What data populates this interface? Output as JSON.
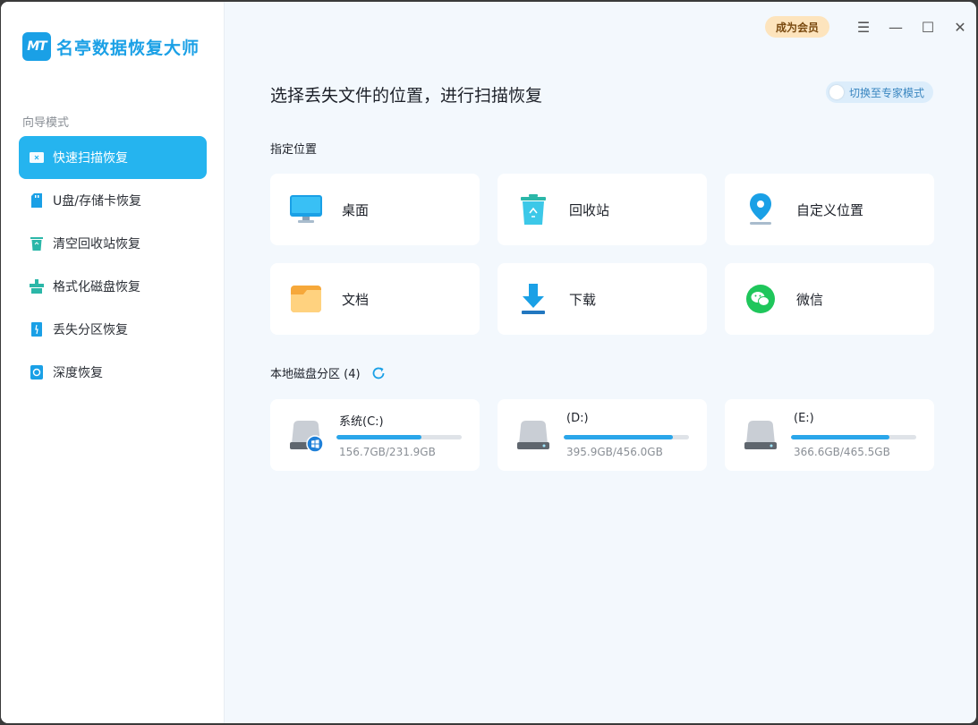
{
  "app": {
    "logo_mark": "MT",
    "title": "名亭数据恢复大师"
  },
  "sidebar": {
    "mode_label": "向导模式",
    "items": [
      {
        "label": "快速扫描恢复",
        "icon": "quick-scan-icon",
        "active": true
      },
      {
        "label": "U盘/存储卡恢复",
        "icon": "sd-card-icon",
        "active": false
      },
      {
        "label": "清空回收站恢复",
        "icon": "recycle-bin-icon",
        "active": false
      },
      {
        "label": "格式化磁盘恢复",
        "icon": "format-disk-icon",
        "active": false
      },
      {
        "label": "丢失分区恢复",
        "icon": "partition-icon",
        "active": false
      },
      {
        "label": "深度恢复",
        "icon": "deep-scan-icon",
        "active": false
      }
    ]
  },
  "titlebar": {
    "vip_label": "成为会员",
    "menu_icon": "☰",
    "minimize_icon": "—",
    "maximize_icon": "☐",
    "close_icon": "✕"
  },
  "main": {
    "title": "选择丢失文件的位置，进行扫描恢复",
    "expert_mode_label": "切换至专家模式",
    "locations_label": "指定位置",
    "locations": [
      {
        "label": "桌面",
        "icon": "desktop-icon"
      },
      {
        "label": "回收站",
        "icon": "recycle-bin-icon"
      },
      {
        "label": "自定义位置",
        "icon": "location-pin-icon"
      },
      {
        "label": "文档",
        "icon": "folder-icon"
      },
      {
        "label": "下载",
        "icon": "download-icon"
      },
      {
        "label": "微信",
        "icon": "wechat-icon"
      }
    ],
    "disks_label": "本地磁盘分区 (4)",
    "disks": [
      {
        "name": "系统(C:)",
        "size": "156.7GB/231.9GB",
        "used_fraction": 0.676,
        "system": true
      },
      {
        "name": "(D:)",
        "size": "395.9GB/456.0GB",
        "used_fraction": 0.868,
        "system": false
      },
      {
        "name": "(E:)",
        "size": "366.6GB/465.5GB",
        "used_fraction": 0.788,
        "system": false
      }
    ]
  },
  "colors": {
    "accent": "#25b4ef",
    "vip_bg": "#fde4bd",
    "background": "#f3f8fd"
  }
}
